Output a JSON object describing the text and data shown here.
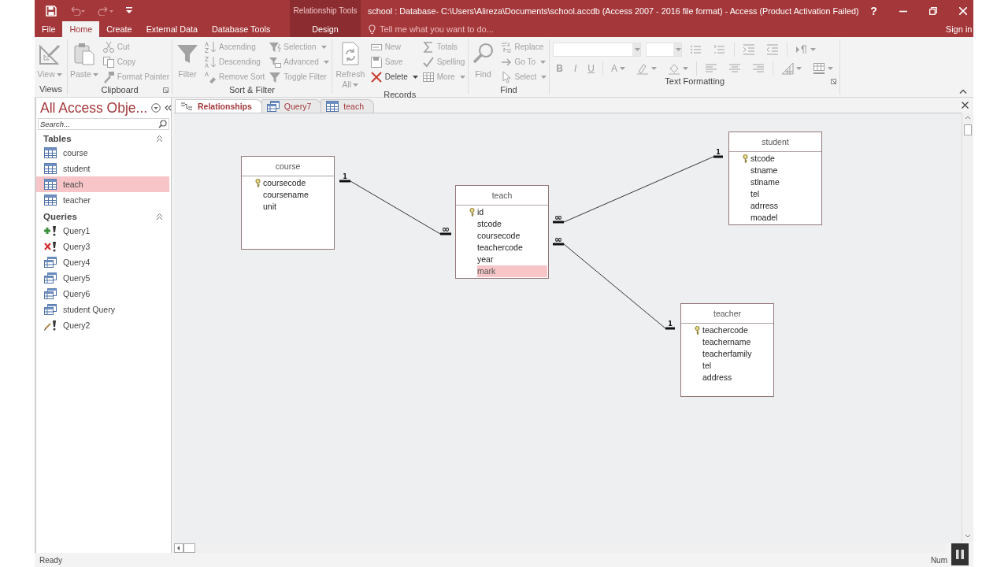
{
  "title_bar": {
    "context_label": "Relationship Tools",
    "title": "school : Database- C:\\Users\\Alireza\\Documents\\school.accdb (Access 2007 - 2016 file format) - Access (Product Activation Failed)",
    "help": "?"
  },
  "ribbon_tabs": [
    {
      "label": "File",
      "selected": false,
      "kind": "standard"
    },
    {
      "label": "Home",
      "selected": true,
      "kind": "standard"
    },
    {
      "label": "Create",
      "selected": false,
      "kind": "standard"
    },
    {
      "label": "External Data",
      "selected": false,
      "kind": "standard"
    },
    {
      "label": "Database Tools",
      "selected": false,
      "kind": "standard"
    },
    {
      "label": "Design",
      "selected": false,
      "kind": "contextual"
    }
  ],
  "tell_me": {
    "placeholder": "Tell me what you want to do..."
  },
  "sign_in": "Sign in",
  "ribbon_groups": [
    {
      "label": "Views",
      "kind": "buttons",
      "launcher": false,
      "buttons": [
        {
          "label": "View",
          "kind": "large",
          "disabled": true,
          "dropdown": true
        }
      ]
    },
    {
      "label": "Clipboard",
      "kind": "buttons",
      "launcher": true,
      "buttons": [
        {
          "label": "Paste",
          "kind": "large",
          "disabled": true,
          "dropdown": true
        },
        {
          "label": "Cut",
          "kind": "small",
          "disabled": true,
          "dropdown": false
        },
        {
          "label": "Copy",
          "kind": "small",
          "disabled": true,
          "dropdown": false
        },
        {
          "label": "Format Painter",
          "kind": "small",
          "disabled": true,
          "dropdown": false
        }
      ]
    },
    {
      "label": "Sort & Filter",
      "kind": "buttons",
      "launcher": false,
      "buttons": [
        {
          "label": "Filter",
          "kind": "large",
          "disabled": true,
          "dropdown": false
        },
        {
          "label": "Ascending",
          "kind": "small",
          "disabled": true,
          "dropdown": false
        },
        {
          "label": "Descending",
          "kind": "small",
          "disabled": true,
          "dropdown": false
        },
        {
          "label": "Remove Sort",
          "kind": "small",
          "disabled": true,
          "dropdown": false
        },
        {
          "label": "Selection",
          "kind": "small",
          "disabled": true,
          "dropdown": true
        },
        {
          "label": "Advanced",
          "kind": "small",
          "disabled": true,
          "dropdown": true
        },
        {
          "label": "Toggle Filter",
          "kind": "small",
          "disabled": true,
          "dropdown": false
        }
      ]
    },
    {
      "label": "Records",
      "kind": "buttons",
      "launcher": false,
      "buttons": [
        {
          "label": "Refresh All",
          "kind": "large",
          "disabled": true,
          "dropdown": true
        },
        {
          "label": "New",
          "kind": "small",
          "disabled": true,
          "dropdown": false
        },
        {
          "label": "Save",
          "kind": "small",
          "disabled": true,
          "dropdown": false
        },
        {
          "label": "Delete",
          "kind": "small",
          "disabled": false,
          "dropdown": true
        },
        {
          "label": "Totals",
          "kind": "small",
          "disabled": true,
          "dropdown": false
        },
        {
          "label": "Spelling",
          "kind": "small",
          "disabled": true,
          "dropdown": false
        },
        {
          "label": "More",
          "kind": "small",
          "disabled": true,
          "dropdown": true
        }
      ]
    },
    {
      "label": "Find",
      "kind": "buttons",
      "launcher": false,
      "buttons": [
        {
          "label": "Find",
          "kind": "large",
          "disabled": true,
          "dropdown": false
        },
        {
          "label": "Replace",
          "kind": "small",
          "disabled": true,
          "dropdown": false
        },
        {
          "label": "Go To",
          "kind": "small",
          "disabled": true,
          "dropdown": true
        },
        {
          "label": "Select",
          "kind": "small",
          "disabled": true,
          "dropdown": true
        }
      ]
    },
    {
      "label": "Text Formatting",
      "kind": "formatting",
      "launcher": true,
      "buttons": [
        {
          "label": "B",
          "disabled": true,
          "dropdown": false
        },
        {
          "label": "I",
          "disabled": true,
          "dropdown": false
        },
        {
          "label": "U",
          "disabled": true,
          "dropdown": false
        },
        {
          "label": "A",
          "disabled": true,
          "dropdown": true
        }
      ]
    }
  ],
  "nav_pane": {
    "title": "All Access Obje...",
    "search": {
      "placeholder": "Search..."
    },
    "groups": [
      {
        "label": "Tables",
        "expanded": true,
        "items": [
          {
            "label": "course",
            "kind": "table",
            "selected": false
          },
          {
            "label": "student",
            "kind": "table",
            "selected": false
          },
          {
            "label": "teach",
            "kind": "table",
            "selected": true
          },
          {
            "label": "teacher",
            "kind": "table",
            "selected": false
          }
        ]
      },
      {
        "label": "Queries",
        "expanded": true,
        "items": [
          {
            "label": "Query1",
            "kind": "append_query",
            "selected": false
          },
          {
            "label": "Query3",
            "kind": "delete_query",
            "selected": false
          },
          {
            "label": "Query4",
            "kind": "select_query",
            "selected": false
          },
          {
            "label": "Query5",
            "kind": "select_query",
            "selected": false
          },
          {
            "label": "Query6",
            "kind": "select_query",
            "selected": false
          },
          {
            "label": "student Query",
            "kind": "select_query",
            "selected": false
          },
          {
            "label": "Query2",
            "kind": "update_query",
            "selected": false
          }
        ]
      }
    ]
  },
  "document_tabs": [
    {
      "label": "Relationships",
      "kind": "relationships",
      "selected": true
    },
    {
      "label": "Query7",
      "kind": "select_query",
      "selected": false
    },
    {
      "label": "teach",
      "kind": "table",
      "selected": false
    }
  ],
  "diagram": {
    "tables": [
      {
        "name": "course",
        "fields": [
          {
            "name": "coursecode",
            "primary_key": true,
            "selected": false
          },
          {
            "name": "coursename",
            "primary_key": false,
            "selected": false
          },
          {
            "name": "unit",
            "primary_key": false,
            "selected": false
          }
        ]
      },
      {
        "name": "teach",
        "fields": [
          {
            "name": "id",
            "primary_key": true,
            "selected": false
          },
          {
            "name": "stcode",
            "primary_key": false,
            "selected": false
          },
          {
            "name": "coursecode",
            "primary_key": false,
            "selected": false
          },
          {
            "name": "teachercode",
            "primary_key": false,
            "selected": false
          },
          {
            "name": "year",
            "primary_key": false,
            "selected": false
          },
          {
            "name": "mark",
            "primary_key": false,
            "selected": true
          }
        ]
      },
      {
        "name": "student",
        "fields": [
          {
            "name": "stcode",
            "primary_key": true,
            "selected": false
          },
          {
            "name": "stname",
            "primary_key": false,
            "selected": false
          },
          {
            "name": "stlname",
            "primary_key": false,
            "selected": false
          },
          {
            "name": "tel",
            "primary_key": false,
            "selected": false
          },
          {
            "name": "adrress",
            "primary_key": false,
            "selected": false
          },
          {
            "name": "moadel",
            "primary_key": false,
            "selected": false
          }
        ]
      },
      {
        "name": "teacher",
        "fields": [
          {
            "name": "teachercode",
            "primary_key": true,
            "selected": false
          },
          {
            "name": "teachername",
            "primary_key": false,
            "selected": false
          },
          {
            "name": "teacherfamily",
            "primary_key": false,
            "selected": false
          },
          {
            "name": "tel",
            "primary_key": false,
            "selected": false
          },
          {
            "name": "address",
            "primary_key": false,
            "selected": false
          }
        ]
      }
    ],
    "relationships": [
      {
        "one_end": "1",
        "many_end": "∞"
      },
      {
        "one_end": "1",
        "many_end": "∞"
      },
      {
        "one_end": "1",
        "many_end": "∞"
      }
    ]
  },
  "status_bar": {
    "text": "Ready",
    "indicator": "Num"
  }
}
